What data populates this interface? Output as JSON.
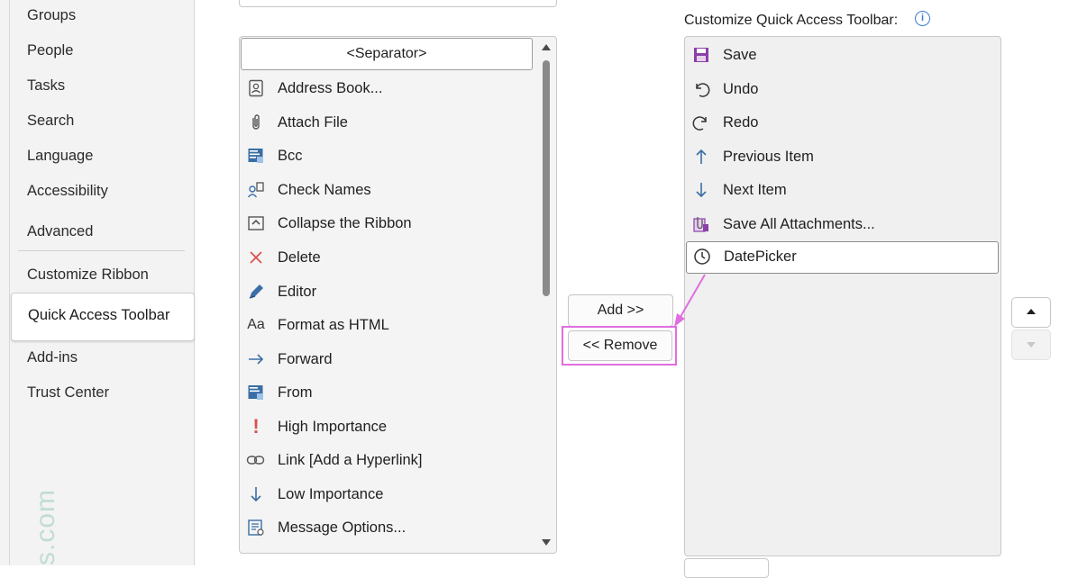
{
  "nav": {
    "items": [
      "Groups",
      "People",
      "Tasks",
      "Search",
      "Language",
      "Accessibility",
      "Advanced",
      "Customize Ribbon"
    ],
    "selected": "Quick Access Toolbar",
    "after": [
      "Add-ins",
      "Trust Center"
    ],
    "watermark": "s.com"
  },
  "commands": {
    "separator": "<Separator>",
    "items": [
      {
        "label": "Address Book...",
        "icon": "address-book-icon"
      },
      {
        "label": "Attach File",
        "icon": "paperclip-icon"
      },
      {
        "label": "Bcc",
        "icon": "bcc-icon"
      },
      {
        "label": "Check Names",
        "icon": "check-names-icon"
      },
      {
        "label": "Collapse the Ribbon",
        "icon": "collapse-ribbon-icon"
      },
      {
        "label": "Delete",
        "icon": "delete-x-icon"
      },
      {
        "label": "Editor",
        "icon": "editor-pen-icon"
      },
      {
        "label": "Format as HTML",
        "icon": "format-text-icon"
      },
      {
        "label": "Forward",
        "icon": "forward-arrow-icon"
      },
      {
        "label": "From",
        "icon": "from-icon"
      },
      {
        "label": "High Importance",
        "icon": "exclamation-icon"
      },
      {
        "label": "Link [Add a Hyperlink]",
        "icon": "link-icon"
      },
      {
        "label": "Low Importance",
        "icon": "down-arrow-icon"
      },
      {
        "label": "Message Options...",
        "icon": "message-options-icon"
      }
    ]
  },
  "buttons": {
    "add": "Add >>",
    "remove": "<< Remove"
  },
  "qat": {
    "title": "Customize Quick Access Toolbar:",
    "items": [
      {
        "label": "Save",
        "icon": "save-icon"
      },
      {
        "label": "Undo",
        "icon": "undo-icon"
      },
      {
        "label": "Redo",
        "icon": "redo-icon"
      },
      {
        "label": "Previous Item",
        "icon": "up-arrow-icon"
      },
      {
        "label": "Next Item",
        "icon": "down-arrow-icon"
      },
      {
        "label": "Save All Attachments...",
        "icon": "attachments-icon"
      },
      {
        "label": "DatePicker",
        "icon": "clock-icon"
      }
    ],
    "selected": "DatePicker"
  },
  "colors": {
    "highlight": "#e06ee0",
    "icon_blue": "#3a6ea5",
    "delete_red": "#d9534f",
    "save_purple": "#8b3fa8"
  }
}
